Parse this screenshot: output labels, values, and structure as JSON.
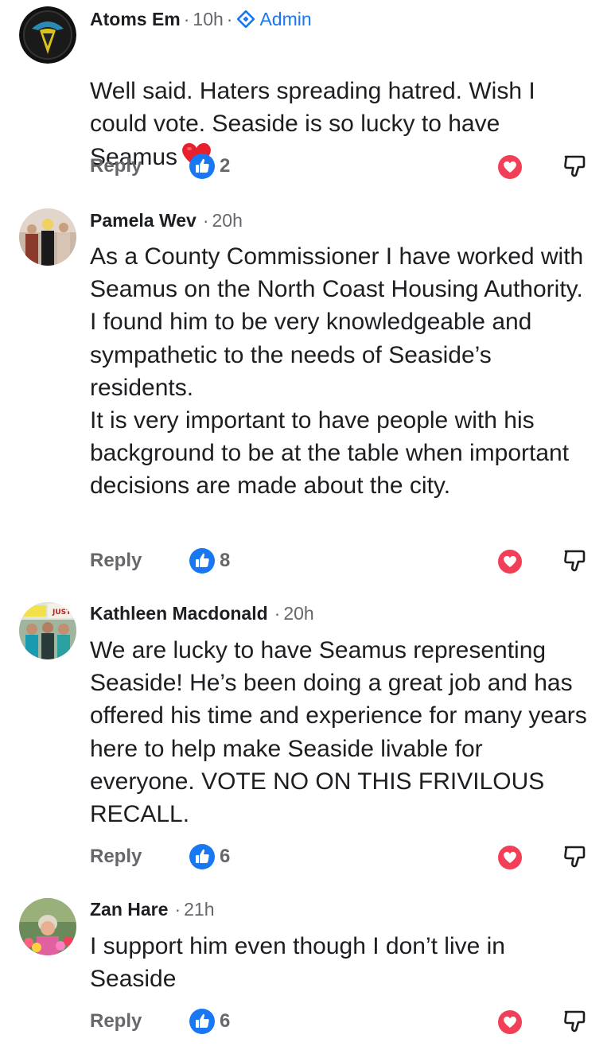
{
  "comments": [
    {
      "name": "Atoms Em",
      "time": "10h",
      "badge": "Admin",
      "text": "Well said. Haters spreading hatred. Wish I could vote. Seaside is so lucky to have Seamus",
      "emoji": "red-heart",
      "reply": "Reply",
      "likes": "2"
    },
    {
      "name": "Pamela Wev",
      "time": "20h",
      "text": "As a County Commissioner I have worked with Seamus on the North Coast Housing Authority. I found him to be very knowledgeable and sympathetic to the needs of Seaside’s residents.\nIt is very important to have people with his background to be at the table when important decisions are made about the city.",
      "reply": "Reply",
      "likes": "8"
    },
    {
      "name": "Kathleen Macdonald",
      "time": "20h",
      "text": "We are lucky to have Seamus representing Seaside!  He’s been doing a great job and has offered his time and experience for many years here to help make Seaside livable for everyone. VOTE NO ON THIS FRIVILOUS RECALL.",
      "avatar_sign": "JUSTI",
      "reply": "Reply",
      "likes": "6"
    },
    {
      "name": "Zan Hare",
      "time": "21h",
      "text": "I support him even though I don’t live in Seaside",
      "reply": "Reply",
      "likes": "6"
    }
  ],
  "colors": {
    "brand_blue": "#1877f2",
    "secondary_text": "#65676b",
    "love_red": "#f33e58"
  },
  "icons": [
    "admin-diamond-icon",
    "like-icon",
    "love-icon",
    "dislike-icon",
    "red-heart-emoji"
  ]
}
